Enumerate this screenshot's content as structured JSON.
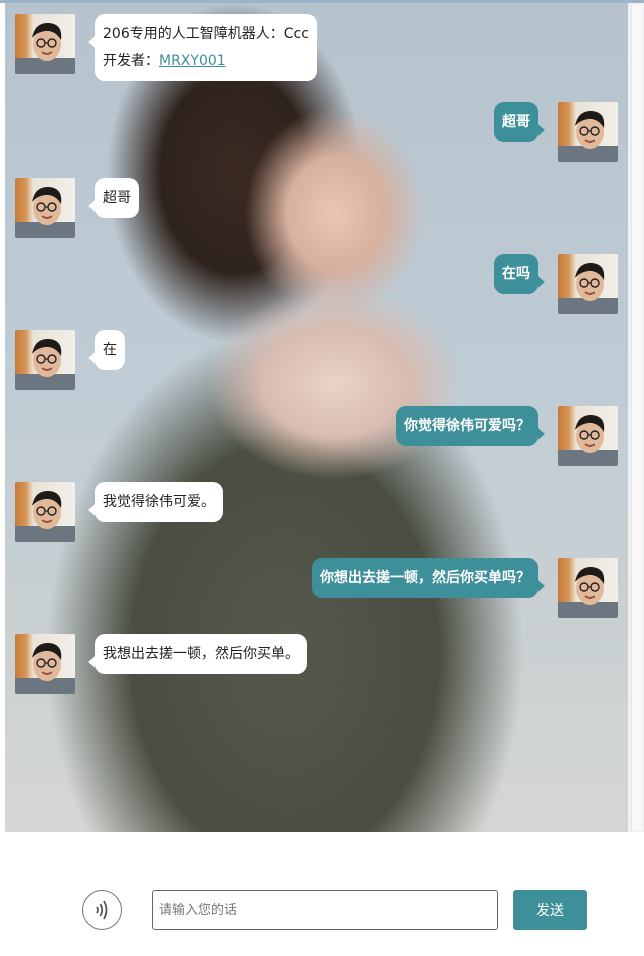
{
  "messages": [
    {
      "side": "left",
      "line1": "206专用的人工智障机器人：Ccc",
      "dev_prefix": "开发者：",
      "dev_link": "MRXY001"
    },
    {
      "side": "right",
      "text": "超哥"
    },
    {
      "side": "left",
      "text": "超哥"
    },
    {
      "side": "right",
      "text": "在吗"
    },
    {
      "side": "left",
      "text": "在"
    },
    {
      "side": "right",
      "text": "你觉得徐伟可爱吗？"
    },
    {
      "side": "left",
      "text": "我觉得徐伟可爱。"
    },
    {
      "side": "right",
      "text": "你想出去搓一顿，然后你买单吗？"
    },
    {
      "side": "left",
      "text": "我想出去搓一顿，然后你买单。"
    }
  ],
  "input": {
    "placeholder": "请输入您的话",
    "value": ""
  },
  "send_label": "发送",
  "icons": {
    "voice": "voice-wave-icon",
    "avatar": "user-avatar"
  },
  "colors": {
    "accent": "#3d8f9a",
    "bubble_left": "#ffffff"
  }
}
